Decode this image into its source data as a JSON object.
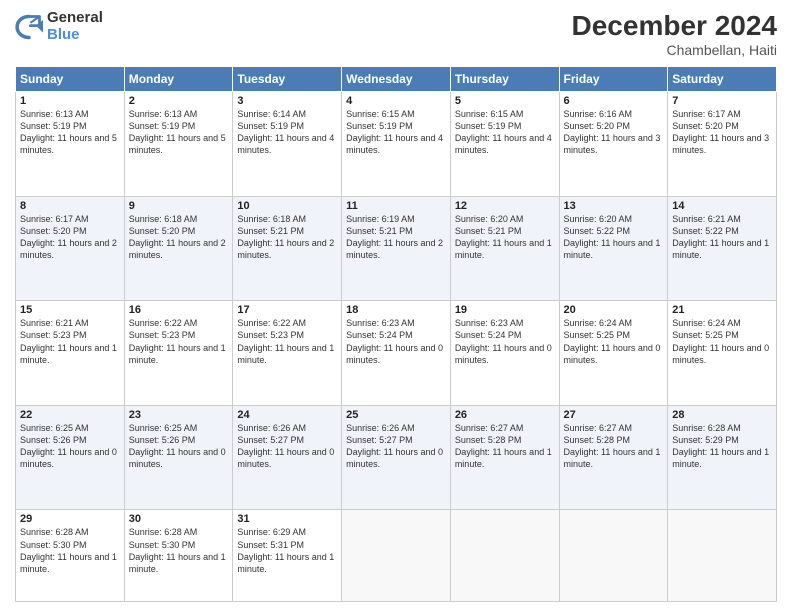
{
  "logo": {
    "general": "General",
    "blue": "Blue"
  },
  "header": {
    "month": "December 2024",
    "location": "Chambellan, Haiti"
  },
  "days_of_week": [
    "Sunday",
    "Monday",
    "Tuesday",
    "Wednesday",
    "Thursday",
    "Friday",
    "Saturday"
  ],
  "weeks": [
    [
      {
        "day": "1",
        "sunrise": "6:13 AM",
        "sunset": "5:19 PM",
        "daylight": "11 hours and 5 minutes."
      },
      {
        "day": "2",
        "sunrise": "6:13 AM",
        "sunset": "5:19 PM",
        "daylight": "11 hours and 5 minutes."
      },
      {
        "day": "3",
        "sunrise": "6:14 AM",
        "sunset": "5:19 PM",
        "daylight": "11 hours and 4 minutes."
      },
      {
        "day": "4",
        "sunrise": "6:15 AM",
        "sunset": "5:19 PM",
        "daylight": "11 hours and 4 minutes."
      },
      {
        "day": "5",
        "sunrise": "6:15 AM",
        "sunset": "5:19 PM",
        "daylight": "11 hours and 4 minutes."
      },
      {
        "day": "6",
        "sunrise": "6:16 AM",
        "sunset": "5:20 PM",
        "daylight": "11 hours and 3 minutes."
      },
      {
        "day": "7",
        "sunrise": "6:17 AM",
        "sunset": "5:20 PM",
        "daylight": "11 hours and 3 minutes."
      }
    ],
    [
      {
        "day": "8",
        "sunrise": "6:17 AM",
        "sunset": "5:20 PM",
        "daylight": "11 hours and 2 minutes."
      },
      {
        "day": "9",
        "sunrise": "6:18 AM",
        "sunset": "5:20 PM",
        "daylight": "11 hours and 2 minutes."
      },
      {
        "day": "10",
        "sunrise": "6:18 AM",
        "sunset": "5:21 PM",
        "daylight": "11 hours and 2 minutes."
      },
      {
        "day": "11",
        "sunrise": "6:19 AM",
        "sunset": "5:21 PM",
        "daylight": "11 hours and 2 minutes."
      },
      {
        "day": "12",
        "sunrise": "6:20 AM",
        "sunset": "5:21 PM",
        "daylight": "11 hours and 1 minute."
      },
      {
        "day": "13",
        "sunrise": "6:20 AM",
        "sunset": "5:22 PM",
        "daylight": "11 hours and 1 minute."
      },
      {
        "day": "14",
        "sunrise": "6:21 AM",
        "sunset": "5:22 PM",
        "daylight": "11 hours and 1 minute."
      }
    ],
    [
      {
        "day": "15",
        "sunrise": "6:21 AM",
        "sunset": "5:23 PM",
        "daylight": "11 hours and 1 minute."
      },
      {
        "day": "16",
        "sunrise": "6:22 AM",
        "sunset": "5:23 PM",
        "daylight": "11 hours and 1 minute."
      },
      {
        "day": "17",
        "sunrise": "6:22 AM",
        "sunset": "5:23 PM",
        "daylight": "11 hours and 1 minute."
      },
      {
        "day": "18",
        "sunrise": "6:23 AM",
        "sunset": "5:24 PM",
        "daylight": "11 hours and 0 minutes."
      },
      {
        "day": "19",
        "sunrise": "6:23 AM",
        "sunset": "5:24 PM",
        "daylight": "11 hours and 0 minutes."
      },
      {
        "day": "20",
        "sunrise": "6:24 AM",
        "sunset": "5:25 PM",
        "daylight": "11 hours and 0 minutes."
      },
      {
        "day": "21",
        "sunrise": "6:24 AM",
        "sunset": "5:25 PM",
        "daylight": "11 hours and 0 minutes."
      }
    ],
    [
      {
        "day": "22",
        "sunrise": "6:25 AM",
        "sunset": "5:26 PM",
        "daylight": "11 hours and 0 minutes."
      },
      {
        "day": "23",
        "sunrise": "6:25 AM",
        "sunset": "5:26 PM",
        "daylight": "11 hours and 0 minutes."
      },
      {
        "day": "24",
        "sunrise": "6:26 AM",
        "sunset": "5:27 PM",
        "daylight": "11 hours and 0 minutes."
      },
      {
        "day": "25",
        "sunrise": "6:26 AM",
        "sunset": "5:27 PM",
        "daylight": "11 hours and 0 minutes."
      },
      {
        "day": "26",
        "sunrise": "6:27 AM",
        "sunset": "5:28 PM",
        "daylight": "11 hours and 1 minute."
      },
      {
        "day": "27",
        "sunrise": "6:27 AM",
        "sunset": "5:28 PM",
        "daylight": "11 hours and 1 minute."
      },
      {
        "day": "28",
        "sunrise": "6:28 AM",
        "sunset": "5:29 PM",
        "daylight": "11 hours and 1 minute."
      }
    ],
    [
      {
        "day": "29",
        "sunrise": "6:28 AM",
        "sunset": "5:30 PM",
        "daylight": "11 hours and 1 minute."
      },
      {
        "day": "30",
        "sunrise": "6:28 AM",
        "sunset": "5:30 PM",
        "daylight": "11 hours and 1 minute."
      },
      {
        "day": "31",
        "sunrise": "6:29 AM",
        "sunset": "5:31 PM",
        "daylight": "11 hours and 1 minute."
      },
      null,
      null,
      null,
      null
    ]
  ]
}
